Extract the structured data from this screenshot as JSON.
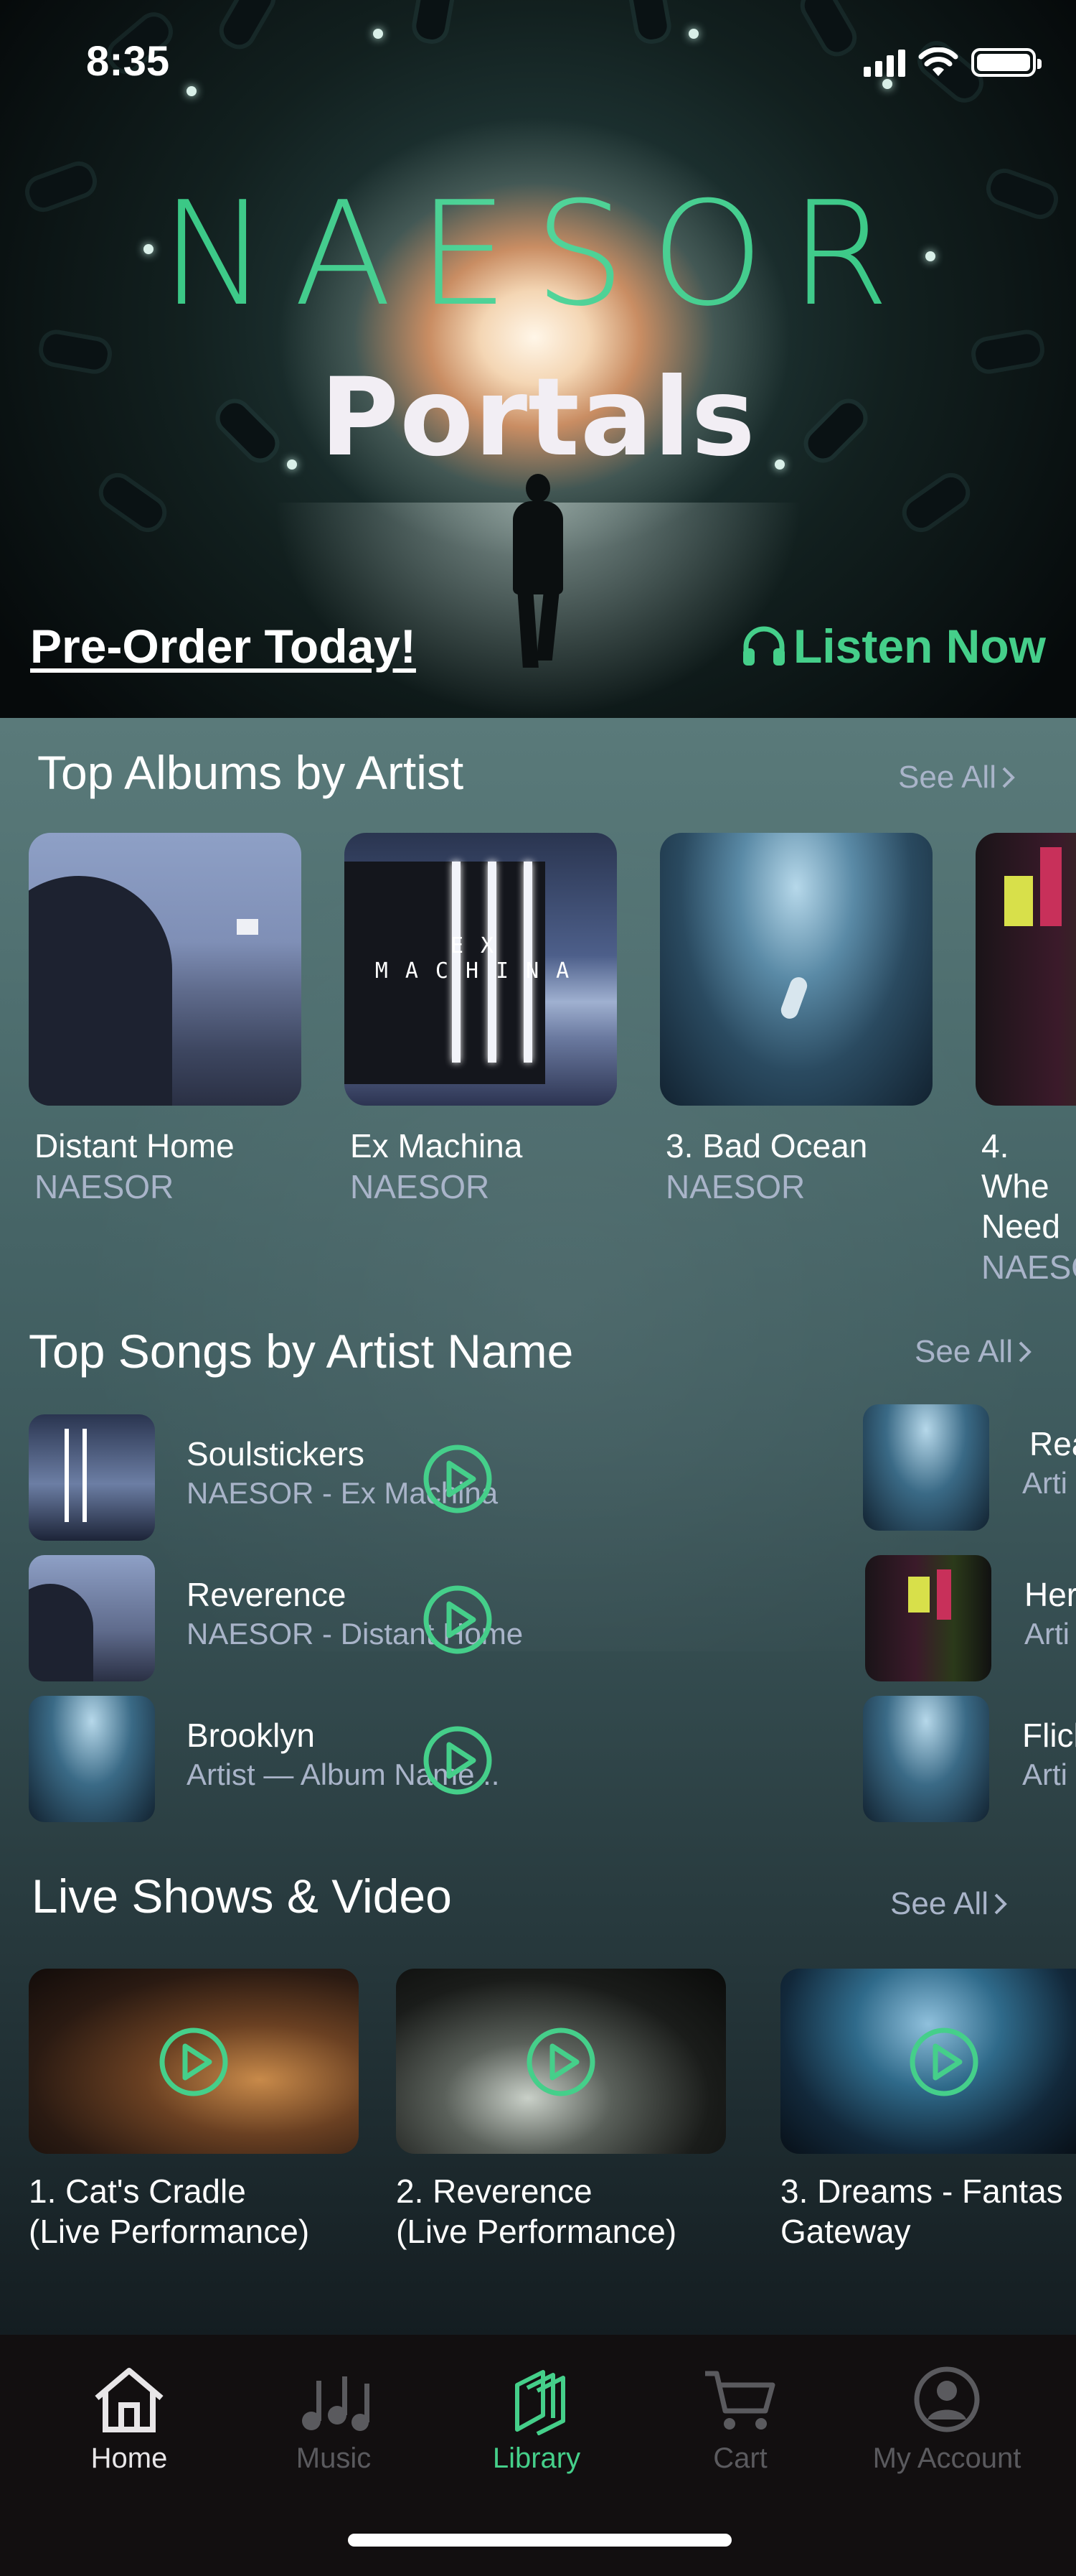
{
  "status_bar": {
    "time": "8:35"
  },
  "hero": {
    "logo_text": "NAESOR",
    "title": "Portals",
    "preorder_label": "Pre-Order Today!",
    "listen_label": "Listen Now",
    "listen_icon": "headphones-icon"
  },
  "albums_section": {
    "title": "Top Albums by Artist",
    "see_all": "See All",
    "items": [
      {
        "name": "Distant Home",
        "artist": "NAESOR"
      },
      {
        "name": "Ex Machina",
        "artist": "NAESOR",
        "art_text": "EX MACHINA"
      },
      {
        "name": "3. Bad Ocean",
        "artist": "NAESOR"
      },
      {
        "name": "4. Whe Need",
        "artist": "NAESO"
      }
    ]
  },
  "songs_section": {
    "title": "Top Songs by Artist Name",
    "see_all": "See All",
    "items": [
      {
        "title": "Soulstickers",
        "subtitle": "NAESOR - Ex Machina"
      },
      {
        "title": "Reverence",
        "subtitle": "NAESOR - Distant Home"
      },
      {
        "title": "Brooklyn",
        "subtitle": "Artist — Album Name..."
      }
    ],
    "right_items": [
      {
        "title": "Rea",
        "subtitle": "Arti"
      },
      {
        "title": "Her",
        "subtitle": "Arti"
      },
      {
        "title": "Flicl",
        "subtitle": "Arti"
      }
    ]
  },
  "videos_section": {
    "title": "Live Shows & Video",
    "see_all": "See All",
    "items": [
      {
        "caption": "1. Cat's Cradle\n(Live Performance)"
      },
      {
        "caption": "2. Reverence\n(Live Performance)"
      },
      {
        "caption": "3. Dreams - Fantas\nGateway"
      }
    ]
  },
  "tab_bar": {
    "active": "Library",
    "tabs": [
      {
        "label": "Home",
        "icon": "home-icon"
      },
      {
        "label": "Music",
        "icon": "music-notes-icon"
      },
      {
        "label": "Library",
        "icon": "library-icon"
      },
      {
        "label": "Cart",
        "icon": "cart-icon"
      },
      {
        "label": "My Account",
        "icon": "account-icon"
      }
    ]
  },
  "colors": {
    "accent_green": "#45cf8a",
    "muted_text": "#a9b4c9",
    "tab_active": "#45cf8a",
    "tab_home": "#e8e6e8",
    "tab_inactive": "#5a5a5e"
  }
}
